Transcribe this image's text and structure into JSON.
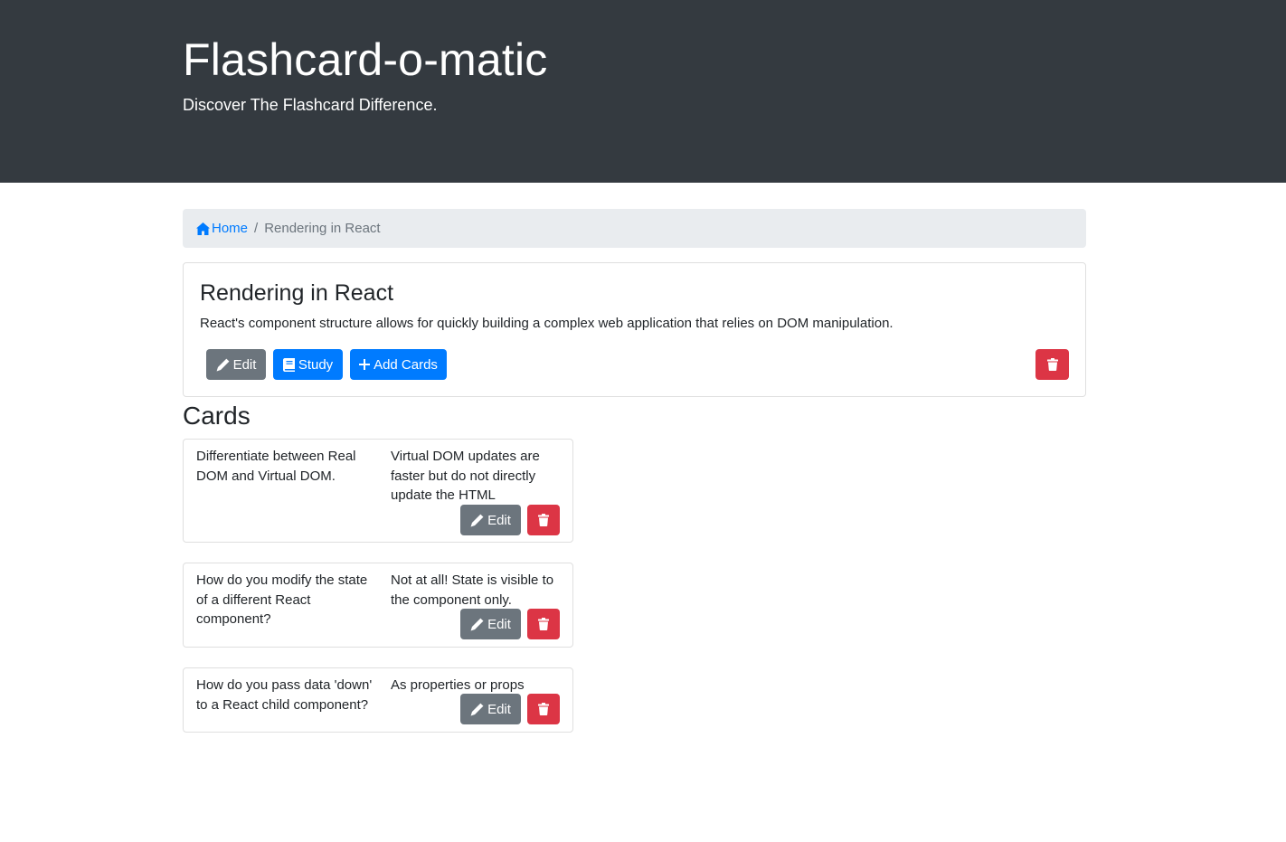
{
  "header": {
    "title": "Flashcard-o-matic",
    "subtitle": "Discover The Flashcard Difference."
  },
  "breadcrumb": {
    "home_label": "Home",
    "separator": "/",
    "current": "Rendering in React"
  },
  "deck": {
    "name": "Rendering in React",
    "description": "React's component structure allows for quickly building a complex web application that relies on DOM manipulation.",
    "edit_label": "Edit",
    "study_label": "Study",
    "add_cards_label": "Add Cards"
  },
  "cards_heading": "Cards",
  "cards": [
    {
      "front": "Differentiate between Real DOM and Virtual DOM.",
      "back": "Virtual DOM updates are faster but do not directly update the HTML",
      "edit_label": "Edit"
    },
    {
      "front": "How do you modify the state of a different React component?",
      "back": "Not at all! State is visible to the component only.",
      "edit_label": "Edit"
    },
    {
      "front": "How do you pass data 'down' to a React child component?",
      "back": "As properties or props",
      "edit_label": "Edit"
    }
  ],
  "colors": {
    "header_bg": "#343a40",
    "primary": "#007bff",
    "secondary": "#6c757d",
    "danger": "#dc3545",
    "breadcrumb_bg": "#e9ecef"
  },
  "icons": {
    "home": "home-icon",
    "edit": "pencil-icon",
    "study": "book-icon",
    "add": "plus-icon",
    "delete": "trash-icon"
  }
}
